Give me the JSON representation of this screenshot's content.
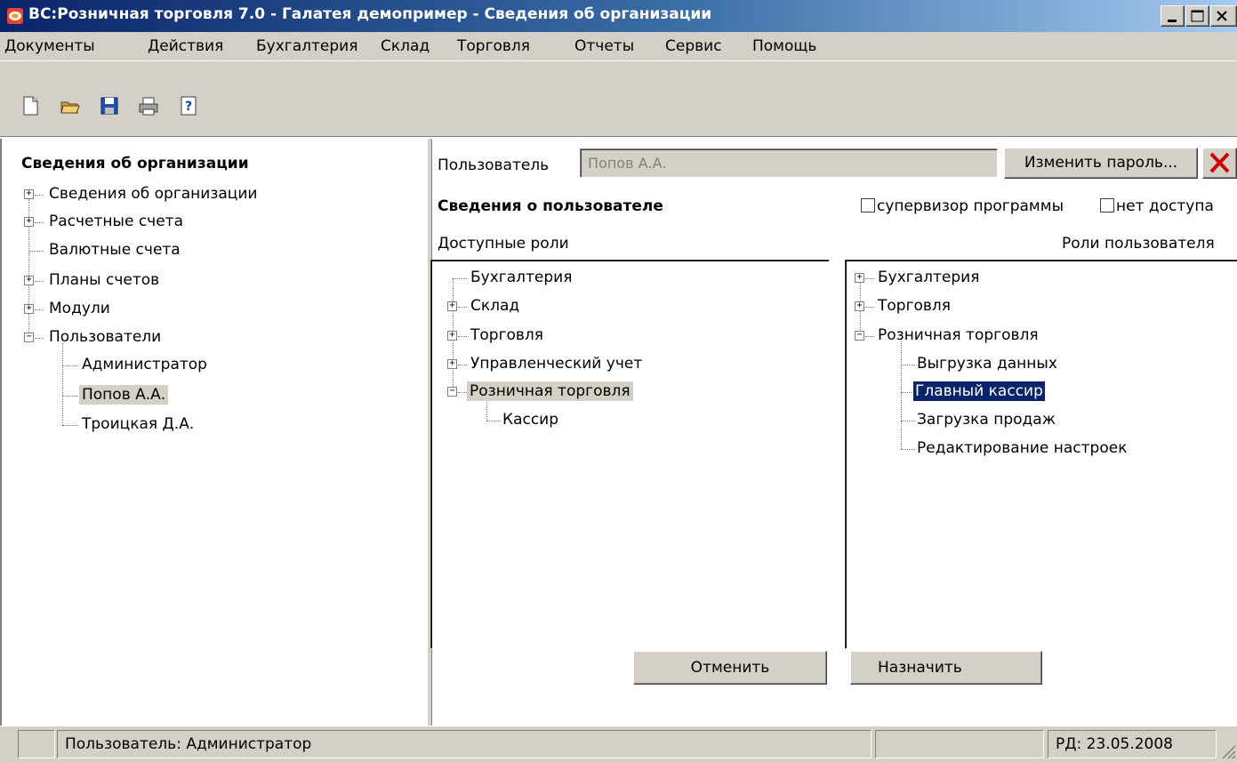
{
  "window": {
    "title": "ВС:Розничная торговля 7.0 - Галатея демопример - Сведения об организации",
    "app_icon": "app-logo-icon",
    "controls": [
      "minimize-icon",
      "maximize-icon",
      "close-icon"
    ]
  },
  "menu": {
    "items": [
      {
        "label": "Документы"
      },
      {
        "label": "Действия"
      },
      {
        "label": "Бухгалтерия"
      },
      {
        "label": "Склад"
      },
      {
        "label": "Торговля"
      },
      {
        "label": "Отчеты"
      },
      {
        "label": "Сервис"
      },
      {
        "label": "Помощь"
      }
    ]
  },
  "toolbar": {
    "icons": [
      "new-document-icon",
      "open-folder-icon",
      "save-icon",
      "print-icon",
      "help-icon"
    ]
  },
  "left_tree": {
    "title": "Сведения об организации",
    "items": [
      {
        "label": "Сведения об организации",
        "expander": "+"
      },
      {
        "label": "Расчетные счета",
        "expander": "+"
      },
      {
        "label": "Валютные счета",
        "expander": ""
      },
      {
        "label": "Планы счетов",
        "expander": "+"
      },
      {
        "label": "Модули",
        "expander": "+"
      },
      {
        "label": "Пользователи",
        "expander": "−"
      },
      {
        "label": "Администратор",
        "expander": ""
      },
      {
        "label": "Попов А.А.",
        "expander": "",
        "selected": true
      },
      {
        "label": "Троицкая Д.А.",
        "expander": ""
      }
    ]
  },
  "user_panel": {
    "user_label": "Пользователь",
    "user_value": "Попов А.А.",
    "change_password": "Изменить пароль...",
    "section_title": "Сведения о пользователе",
    "supervisor_label": "супервизор программы",
    "supervisor_checked": false,
    "no_access_label": "нет доступа",
    "no_access_checked": false,
    "available_roles_label": "Доступные роли",
    "user_roles_label": "Роли пользователя",
    "available_roles": [
      {
        "label": "Бухгалтерия",
        "expander": ""
      },
      {
        "label": "Склад",
        "expander": "+"
      },
      {
        "label": "Торговля",
        "expander": "+"
      },
      {
        "label": "Управленческий учет",
        "expander": "+"
      },
      {
        "label": "Розничная торговля",
        "expander": "−",
        "selected": true
      },
      {
        "label": "Кассир",
        "expander": ""
      }
    ],
    "user_roles": [
      {
        "label": "Бухгалтерия",
        "expander": "+"
      },
      {
        "label": "Торговля",
        "expander": "+"
      },
      {
        "label": "Розничная торговля",
        "expander": "−"
      },
      {
        "label": "Выгрузка данных",
        "expander": ""
      },
      {
        "label": "Главный кассир",
        "expander": "",
        "selected": true
      },
      {
        "label": "Загрузка продаж",
        "expander": ""
      },
      {
        "label": "Редактирование настроек",
        "expander": ""
      }
    ],
    "cancel_button": "Отменить",
    "assign_button": "Назначить"
  },
  "status": {
    "user": "Пользователь: Администратор",
    "date": "РД: 23.05.2008"
  },
  "colors": {
    "title_bar": "#0a246a",
    "face": "#d4d0c8",
    "selection": "#0a246a",
    "close_red": "#cc0000"
  }
}
